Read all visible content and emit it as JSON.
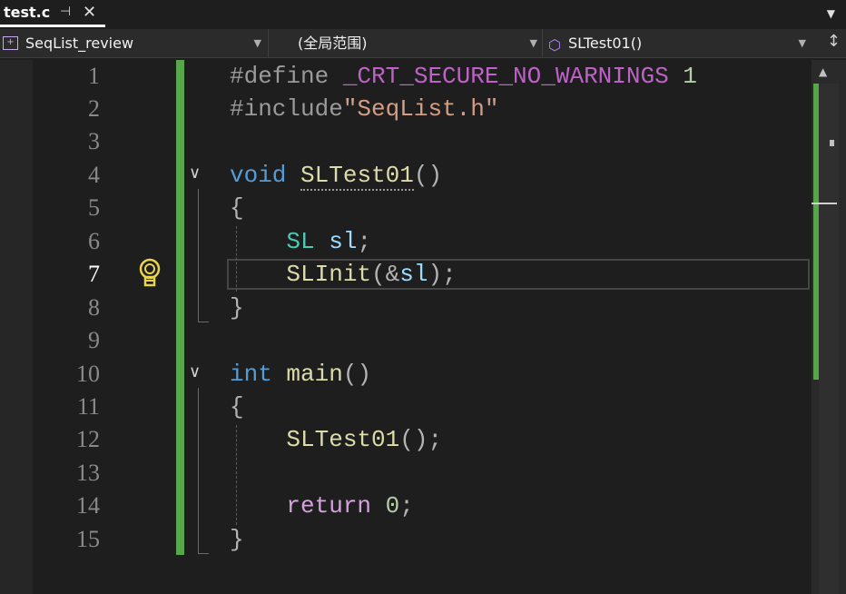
{
  "tab": {
    "title": "test.c",
    "pin_icon": "pin-icon",
    "close_icon": "close-icon"
  },
  "navbar": {
    "file": "SeqList_review",
    "scope": "(全局范围)",
    "member": "SLTest01()"
  },
  "editor": {
    "line_numbers": [
      "1",
      "2",
      "3",
      "4",
      "5",
      "6",
      "7",
      "8",
      "9",
      "10",
      "11",
      "12",
      "13",
      "14",
      "15"
    ],
    "current_line": "7",
    "lines": {
      "l1": {
        "directive": "#define",
        "macro": "_CRT_SECURE_NO_WARNINGS",
        "value": "1"
      },
      "l2": {
        "directive": "#include",
        "path": "\"SeqList.h\""
      },
      "l4": {
        "kw": "void",
        "fn": "SLTest01",
        "paren": "()"
      },
      "l5": {
        "brace": "{"
      },
      "l6": {
        "type": "SL",
        "var": "sl",
        "semi": ";"
      },
      "l7": {
        "fn": "SLInit",
        "open": "(&",
        "var": "sl",
        "close": ");"
      },
      "l8": {
        "brace": "}"
      },
      "l10": {
        "kw": "int",
        "fn": "main",
        "paren": "()"
      },
      "l11": {
        "brace": "{"
      },
      "l12": {
        "fn": "SLTest01",
        "rest": "();"
      },
      "l14": {
        "kw": "return",
        "num": "0",
        "semi": ";"
      },
      "l15": {
        "brace": "}"
      }
    }
  },
  "colors": {
    "background": "#1e1e1e",
    "change_bar": "#57a64a",
    "keyword": "#569cd6",
    "function": "#dcdcaa",
    "type": "#4ec9b0",
    "variable": "#9cdcfe",
    "string": "#d69d85",
    "macro": "#bd63c5",
    "number": "#b5cea8"
  }
}
